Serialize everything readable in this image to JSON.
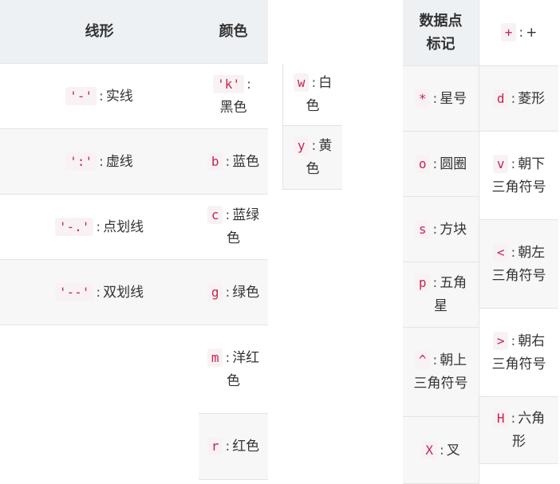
{
  "table_line": {
    "headers": {
      "style": "线形",
      "color": "颜色"
    },
    "styles": [
      {
        "code": "'-'",
        "label": "实线"
      },
      {
        "code": "':'",
        "label": "虚线"
      },
      {
        "code": "'-.'",
        "label": "点划线"
      },
      {
        "code": "'--'",
        "label": "双划线"
      }
    ],
    "colors": [
      {
        "code": "'k'",
        "label": "黑色"
      },
      {
        "code": "b",
        "label": "蓝色"
      },
      {
        "code": "c",
        "label": "蓝绿色"
      },
      {
        "code": "g",
        "label": "绿色"
      },
      {
        "code": "m",
        "label": "洋红色"
      },
      {
        "code": "r",
        "label": "红色"
      }
    ]
  },
  "table_extra_colors": [
    {
      "code": "w",
      "label": "白色"
    },
    {
      "code": "y",
      "label": "黄色"
    }
  ],
  "table_markers": {
    "header": "数据点标记",
    "col1": [
      {
        "code": "*",
        "label": "星号"
      },
      {
        "code": "o",
        "label": "圆圈"
      },
      {
        "code": "s",
        "label": "方块"
      },
      {
        "code": "p",
        "label": "五角星"
      },
      {
        "code": "^",
        "label": "朝上三角符号"
      },
      {
        "code": "X",
        "label": "叉"
      }
    ],
    "col2": [
      {
        "code": "+",
        "label": "+"
      },
      {
        "code": "d",
        "label": "菱形"
      },
      {
        "code": "v",
        "label": "朝下三角符号"
      },
      {
        "code": "<",
        "label": "朝左三角符号"
      },
      {
        "code": ">",
        "label": "朝右三角符号"
      },
      {
        "code": "H",
        "label": "六角形"
      }
    ]
  },
  "separator": ":"
}
